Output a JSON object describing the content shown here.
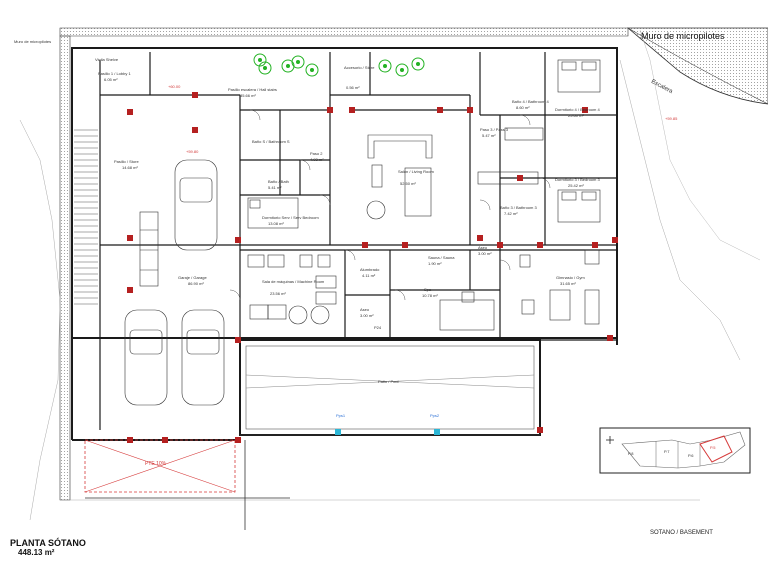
{
  "plan": {
    "title": "PLANTA SÓTANO",
    "area": "448.13 m²",
    "level": "SOTANO / BASEMENT",
    "wall_label": "Muro de micropilotes",
    "wall_label_left": "Muro de micropilotes",
    "stairs_label": "Escalera",
    "slope": "PTE 10%",
    "elevations": [
      "+60.00",
      "+59.80",
      "+59.85"
    ],
    "keymap_labels": [
      "P.8",
      "P.7",
      "P.6",
      "P.5"
    ]
  },
  "rooms": {
    "pasillo1": "Pasillo 1 / Lobby 1",
    "pasillo1_area": "6.05 m²",
    "lobby_top": "Vinila Shelve",
    "pasillo_stairs": "Pasillo escalera / Hall stairs",
    "pasillo_stairs_area": "35.66 m²",
    "accesorio": "Accesorio / Store",
    "accesorio_area": "0.56 m²",
    "bano4": "Baño 4 / Bathroom 4",
    "bano4_area": "8.60 m²",
    "dorm4": "Dormitorio 4 / Bedroom 4",
    "dorm4_area": "25.60 m²",
    "pasillo_store": "Pasillo / Store",
    "pasillo_store_area": "14.68 m²",
    "bano_serv": "Baño S / Bathroom S",
    "paso2": "Paso 2",
    "paso2_area": "4.93 m²",
    "bano3": "Baño 3 / Bathroom 3",
    "bano3_area": "7.42 m²",
    "salon": "Salón / Living Room",
    "salon_area": "52.50 m²",
    "paso3": "Paso 3 / Pass 3",
    "paso3_area": "5.47 m²",
    "dorm3": "Dormitorio 3 / Bedroom 3",
    "dorm3_area": "25.42 m²",
    "dorm_serv": "Dormitorio Serv / Serv Bedroom",
    "dorm_serv_area": "13.08 m²",
    "bano_s2": "Baño / Bath",
    "bano_s2_area": "5.41 m²",
    "garaje": "Garaje / Garage",
    "garaje_area": "86.90 m²",
    "maquinas": "Sala de máquinas / Machine Room",
    "maquinas_area": "23.56 m²",
    "alumbrado": "Alumbrado",
    "alumbrado_area": "4.11 m²",
    "sauna": "Sauna / Sauna",
    "sauna_area": "1.90 m²",
    "spa": "Spa",
    "spa_area": "10.78 m²",
    "aseo": "Aseo",
    "aseo_area": "3.00 m²",
    "gym": "Gimnasio / Gym",
    "gym_area": "31.65 m²",
    "aseo_gym": "Aseo",
    "aseo_gym_area": "3.00 m²",
    "patio": "Patio / Pool",
    "p24": "P24",
    "pile1": "Pps1",
    "pile2": "Pps2"
  },
  "colors": {
    "wall": "#1a1a1a",
    "column": "#b52020",
    "tree": "#22b222",
    "dim": "#9a9a9a",
    "ramp": "#d63a3a",
    "water": "#2bb6d6"
  }
}
